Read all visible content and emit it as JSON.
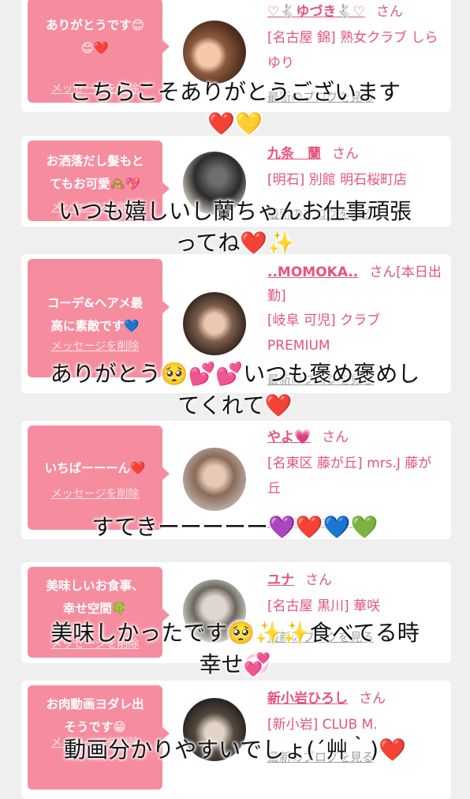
{
  "cards": [
    {
      "message": "ありがとうです😊\n😊❤️",
      "delete_label": "メッセージを削除",
      "user_name": "♡🐇ゆづき🐇♡",
      "san": "さん",
      "shop": "[名古屋 錦] 熟女クラブ しらゆり",
      "blog_label": "最新のブログを見る"
    },
    {
      "message": "お洒落だし髪もと\nてもお可愛🙈💖",
      "delete_label": "メッセージを削除",
      "user_name": "九条　蘭",
      "san": "さん",
      "shop": "[明石] 別館 明石桜町店",
      "blog_label": "最新のブログを見る"
    },
    {
      "message": "コーデ&ヘアメ最\n高に素敵です💙",
      "delete_label": "メッセージを削除",
      "user_name": "..MOMOKA..",
      "san": "さん[本日出勤]",
      "shop": "[岐阜 可児] クラブ PREMIUM",
      "blog_label": "最新のブログを見る"
    },
    {
      "message": "いちばーーーん❤️",
      "delete_label": "メッセージを削除",
      "user_name": "やよ💗",
      "san": "さん",
      "shop": "[名東区 藤が丘] mrs.J 藤が丘",
      "blog_label": "最新のブログを見る"
    },
    {
      "message": "美味しいお食事、\n幸せ空間🍀",
      "delete_label": "メッセージを削除",
      "user_name": "ユナ",
      "san": "さん",
      "shop": "[名古屋 黒川] 華咲",
      "blog_label": "最新のブログを見る"
    },
    {
      "message": "お肉動画ヨダレ出\nそうです😁",
      "delete_label": "メッセージを削除",
      "user_name": "新小岩ひろし",
      "san": "さん",
      "shop": "[新小岩] CLUB M.",
      "blog_label": "最新のブログを見る"
    }
  ],
  "overlays": [
    {
      "text": "こちらこそありがとうございます\n❤️💛"
    },
    {
      "text": "いつも嬉しいし蘭ちゃんお仕事頑張\nってね❤️✨"
    },
    {
      "text": "ありがとう🥺💕💕いつも褒め褒めし\nてくれて❤️"
    },
    {
      "text": "すてきーーーーー💜❤️💙💚"
    },
    {
      "text": "美味しかったです🥺✨✨食べてる時\n幸せ💞"
    },
    {
      "text": "動画分かりやすいでしょ(´艸｀)❤️"
    }
  ],
  "colors": {
    "bubble": "#f58d9e",
    "name": "#e5547a",
    "background": "#efefef"
  }
}
